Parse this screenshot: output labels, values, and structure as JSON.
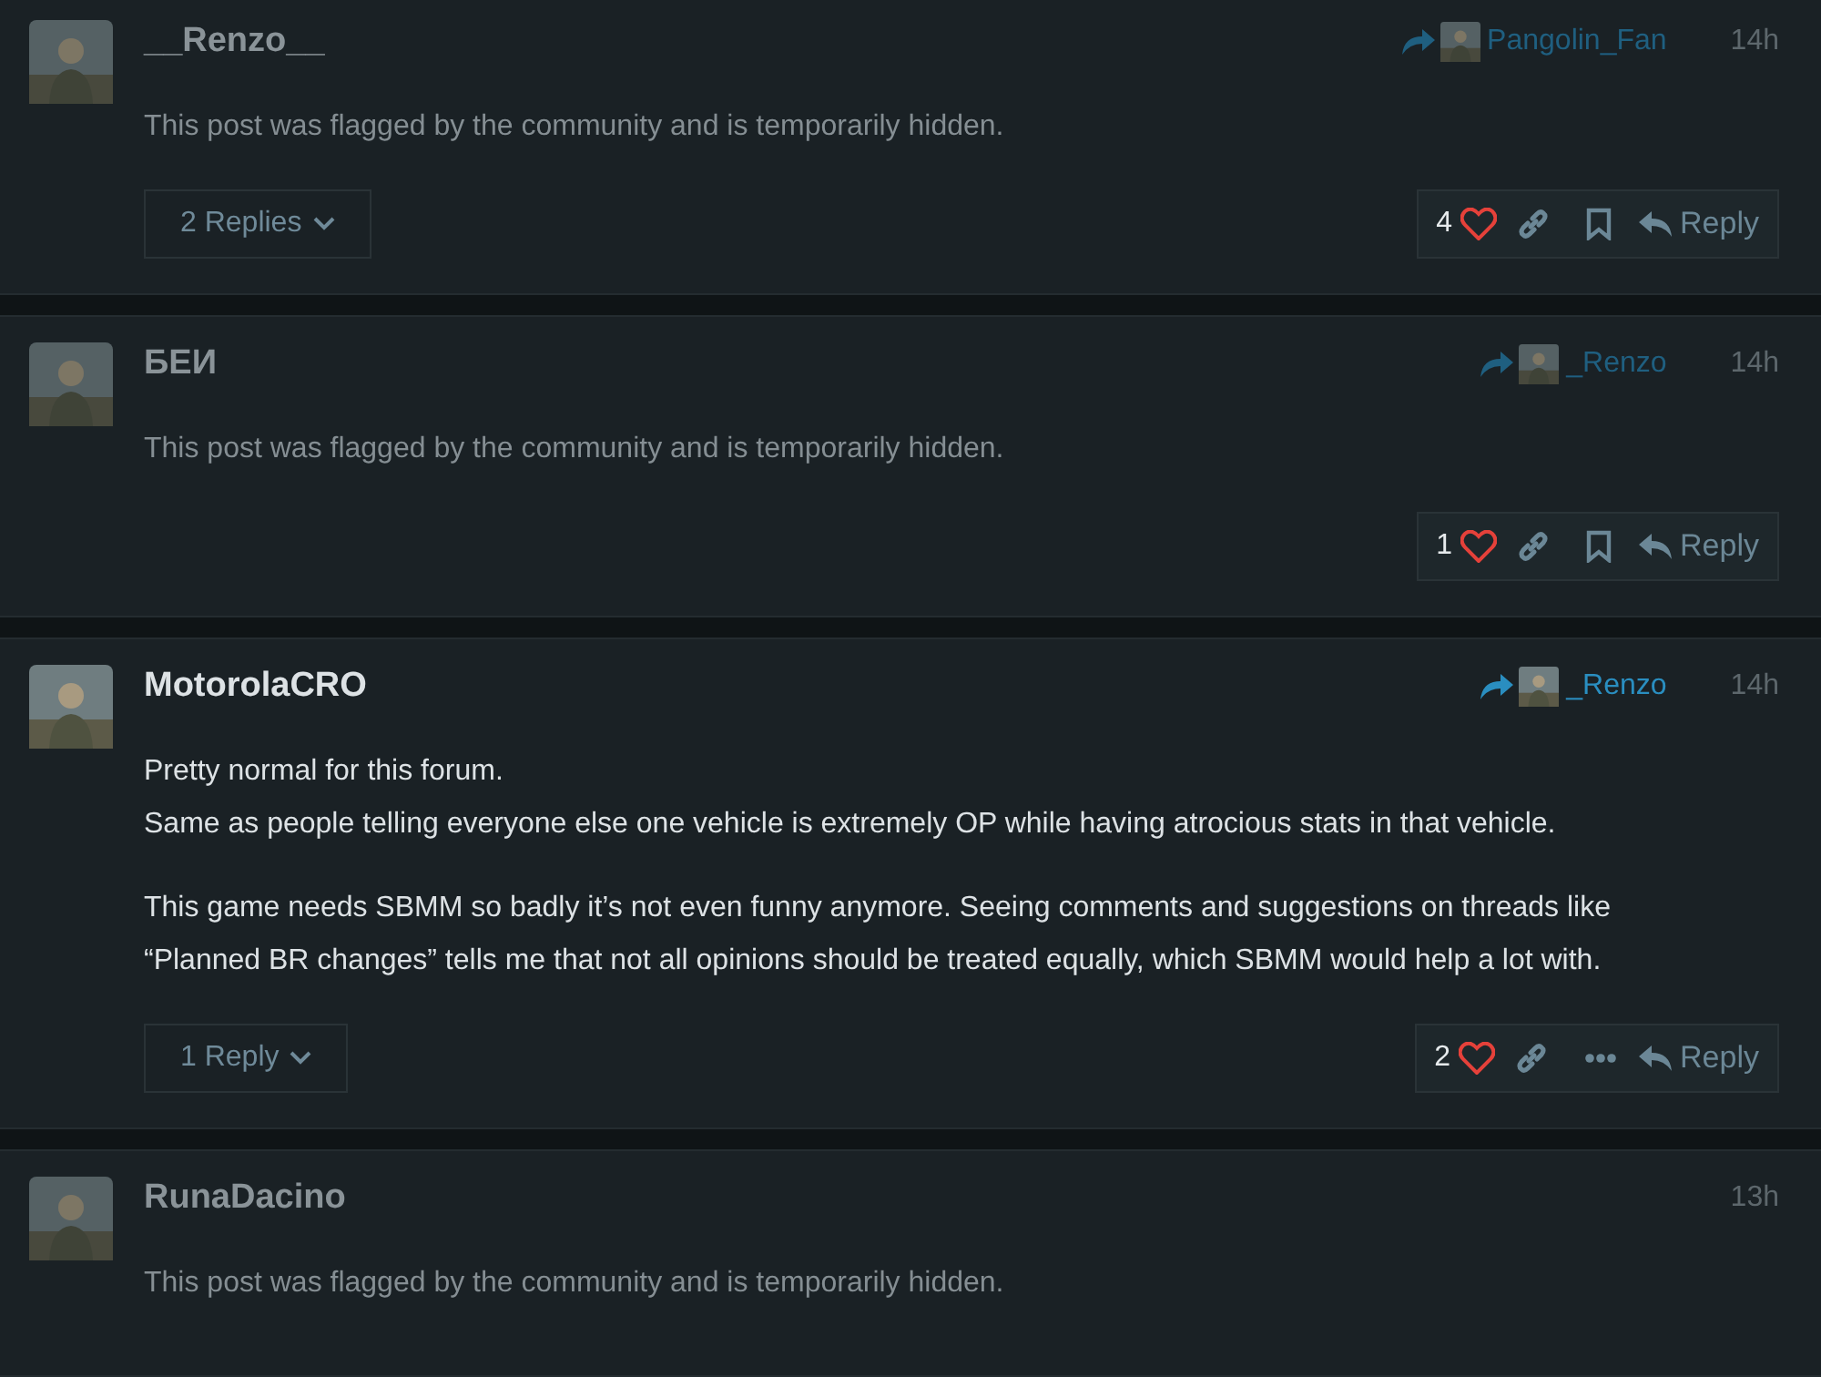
{
  "posts": [
    {
      "author": "__Renzo__",
      "hidden": true,
      "reply_to": {
        "name": "Pangolin_Fan"
      },
      "time": "14h",
      "body": [
        [
          "This post was flagged by the community and is temporarily hidden."
        ]
      ],
      "replies_button": "2 Replies",
      "likes": "4",
      "extra_action": {
        "kind": "bookmark"
      },
      "reply_label": "Reply"
    },
    {
      "author": "БЕИ",
      "hidden": true,
      "reply_to": {
        "name": "_Renzo"
      },
      "time": "14h",
      "body": [
        [
          "This post was flagged by the community and is temporarily hidden."
        ]
      ],
      "likes": "1",
      "extra_action": {
        "kind": "bookmark"
      },
      "reply_label": "Reply"
    },
    {
      "author": "MotorolaCRO",
      "hidden": false,
      "reply_to": {
        "name": "_Renzo"
      },
      "time": "14h",
      "body": [
        [
          "Pretty normal for this forum.",
          "Same as people telling everyone else one vehicle is extremely OP while having atrocious stats in that vehicle."
        ],
        [
          "This game needs SBMM so badly it’s not even funny anymore. Seeing comments and suggestions on threads like “Planned BR changes” tells me that not all opinions should be treated equally, which SBMM would help a lot with."
        ]
      ],
      "replies_button": "1 Reply",
      "likes": "2",
      "extra_action": {
        "kind": "more"
      },
      "reply_label": "Reply"
    },
    {
      "author": "RunaDacino",
      "hidden": true,
      "time": "13h",
      "body": [
        [
          "This post was flagged by the community and is temporarily hidden."
        ]
      ]
    }
  ]
}
